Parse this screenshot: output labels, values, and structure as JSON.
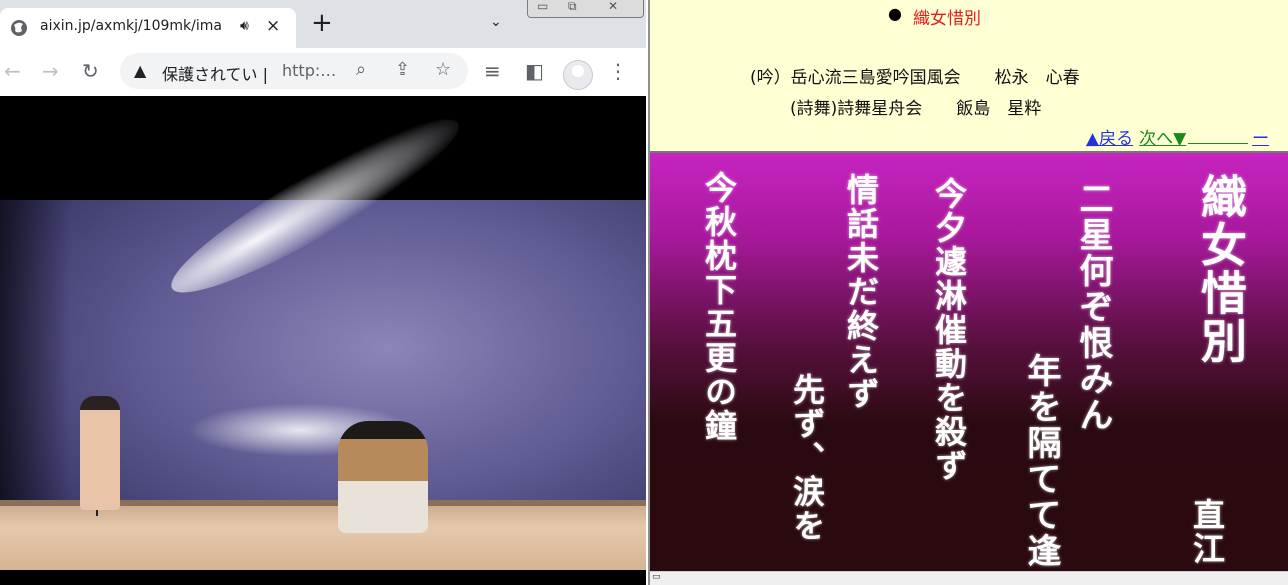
{
  "browser": {
    "tab_title": "aixin.jp/axmkj/109mk/ima",
    "audio_icon": "speaker-icon",
    "tab_close": "×",
    "new_tab": "+",
    "tab_search": "⌄",
    "security_label": "保護されてい",
    "security_sep": "|",
    "url": "http:…",
    "window_controls": [
      "▭",
      "⧉",
      "✕"
    ],
    "icons": [
      "back-icon",
      "forward-icon",
      "reload-icon",
      "warning-icon",
      "zoom-icon",
      "share-icon",
      "star-icon",
      "playlist-icon",
      "side-panel-icon",
      "profile-icon",
      "menu-icon"
    ]
  },
  "page": {
    "title_bullet": "●",
    "title": "織女惜別",
    "performer1": "(吟）岳心流三島愛吟国風会　　松永　心春",
    "performer2": "(詩舞)詩舞星舟会　　飯島　星粋",
    "nav_back": "▲戻る",
    "nav_next": "次へ▼",
    "nav_end": "ー"
  },
  "slide": {
    "col1": "織女惜別",
    "col2": "二星何ぞ恨みん",
    "col3": "年を隔てて逢",
    "col4": "今夕遽淋催動を殺ず",
    "col5": "情話未だ終えず",
    "col6": "先ず、涙を",
    "col7": "今秋枕下五更の鐘",
    "col8": "直江"
  }
}
